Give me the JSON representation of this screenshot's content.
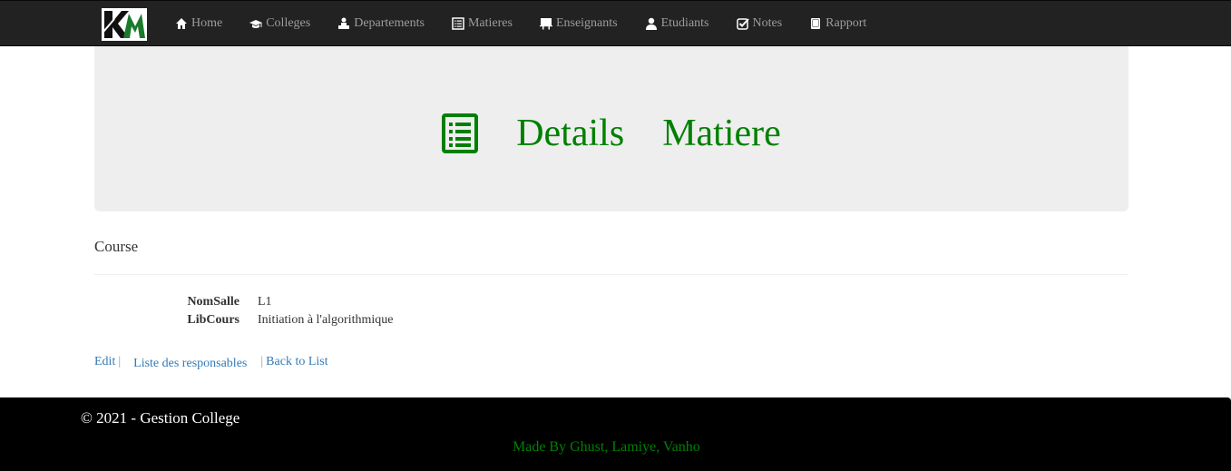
{
  "nav": {
    "brand": {
      "icon": "km-logo-icon"
    },
    "items": [
      {
        "label": "Home",
        "icon": "home-icon"
      },
      {
        "label": "Colleges",
        "icon": "graduation-cap-icon"
      },
      {
        "label": "Departements",
        "icon": "building-icon"
      },
      {
        "label": "Matieres",
        "icon": "list-icon"
      },
      {
        "label": "Enseignants",
        "icon": "blackboard-icon"
      },
      {
        "label": "Etudiants",
        "icon": "user-icon"
      },
      {
        "label": "Notes",
        "icon": "check-square-icon"
      },
      {
        "label": "Rapport",
        "icon": "book-icon"
      }
    ]
  },
  "jumbotron": {
    "icon": "list-alt-icon",
    "title_word1": "Details",
    "title_word2": "Matiere",
    "color": "#008000"
  },
  "content": {
    "section_title": "Course",
    "fields": [
      {
        "label": "NomSalle",
        "value": "L1"
      },
      {
        "label": "LibCours",
        "value": "Initiation à l'algorithmique"
      }
    ],
    "actions": {
      "edit": "Edit",
      "sep1": "|",
      "responsables": "Liste des responsables",
      "sep2": "|",
      "back": "Back to List"
    }
  },
  "footer": {
    "copyright": "© 2021 - Gestion College",
    "made_by": "Made By Ghust, Lamiye, Vanho"
  }
}
